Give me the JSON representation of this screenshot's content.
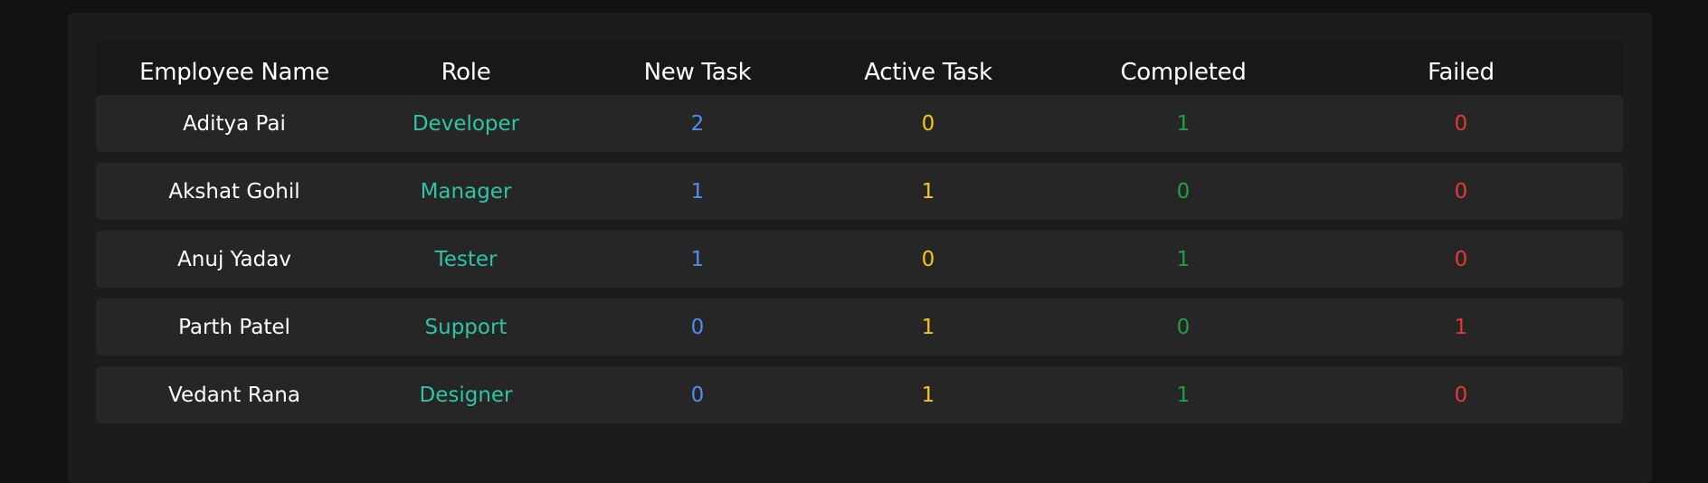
{
  "colors": {
    "page_background": "#111111",
    "panel_background": "#1c1c1c",
    "header_background": "#181818",
    "row_background": "#262626",
    "name": "#ffffff",
    "role": "#2ec4a6",
    "new_task": "#4d8ff0",
    "active_task": "#f5c518",
    "completed": "#22a045",
    "failed": "#e53935"
  },
  "table": {
    "headers": {
      "name": "Employee Name",
      "role": "Role",
      "new_task": "New Task",
      "active_task": "Active Task",
      "completed": "Completed",
      "failed": "Failed"
    },
    "rows": [
      {
        "name": "Aditya Pai",
        "role": "Developer",
        "new_task": "2",
        "active_task": "0",
        "completed": "1",
        "failed": "0"
      },
      {
        "name": "Akshat Gohil",
        "role": "Manager",
        "new_task": "1",
        "active_task": "1",
        "completed": "0",
        "failed": "0"
      },
      {
        "name": "Anuj Yadav",
        "role": "Tester",
        "new_task": "1",
        "active_task": "0",
        "completed": "1",
        "failed": "0"
      },
      {
        "name": "Parth Patel",
        "role": "Support",
        "new_task": "0",
        "active_task": "1",
        "completed": "0",
        "failed": "1"
      },
      {
        "name": "Vedant Rana",
        "role": "Designer",
        "new_task": "0",
        "active_task": "1",
        "completed": "1",
        "failed": "0"
      }
    ]
  }
}
